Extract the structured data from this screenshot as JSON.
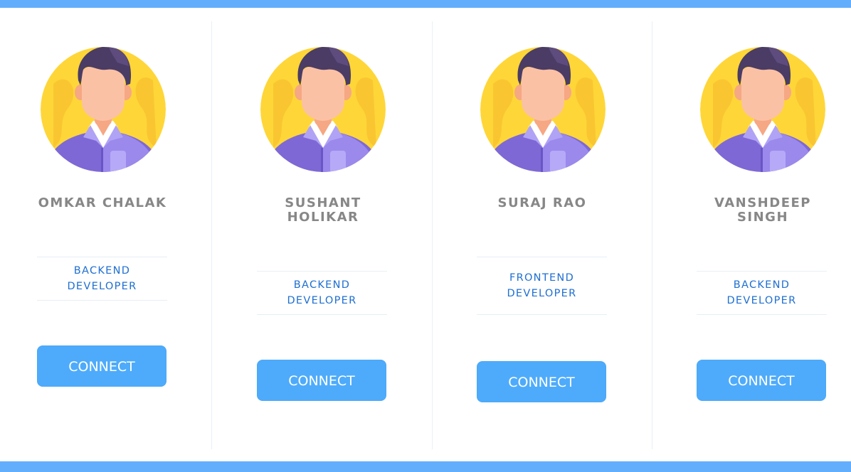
{
  "colors": {
    "accent_bar": "#63aefc",
    "button_bg": "#4eabfb",
    "name_text": "#878787",
    "role_text": "#1f6fd1",
    "divider": "#e7f0f6"
  },
  "team": [
    {
      "name": "OMKAR CHALAK",
      "role": "BACKEND DEVELOPER",
      "button_label": "CONNECT",
      "avatar_icon": "male-developer-avatar-icon"
    },
    {
      "name": "SUSHANT HOLIKAR",
      "role": "BACKEND DEVELOPER",
      "button_label": "CONNECT",
      "avatar_icon": "male-developer-avatar-icon"
    },
    {
      "name": "SURAJ RAO",
      "role": "FRONTEND DEVELOPER",
      "button_label": "CONNECT",
      "avatar_icon": "male-developer-avatar-icon"
    },
    {
      "name": "VANSHDEEP SINGH",
      "role": "BACKEND DEVELOPER",
      "button_label": "CONNECT",
      "avatar_icon": "male-developer-avatar-icon"
    }
  ]
}
